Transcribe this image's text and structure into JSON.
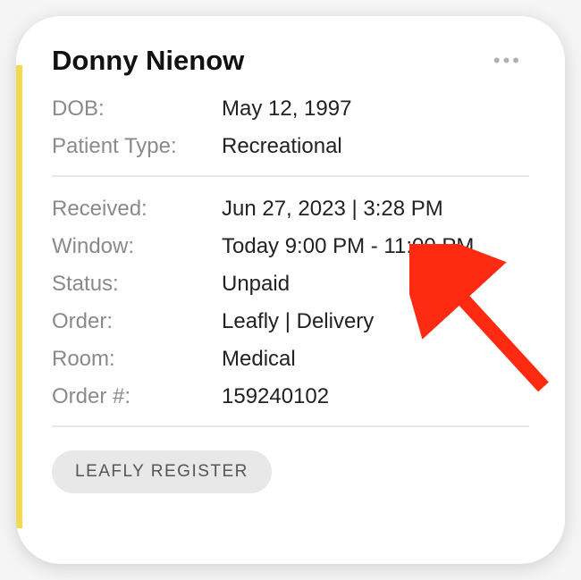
{
  "customer_name": "Donny Nienow",
  "section1": {
    "dob_label": "DOB:",
    "dob_value": "May 12, 1997",
    "patient_type_label": "Patient Type:",
    "patient_type_value": "Recreational"
  },
  "section2": {
    "received_label": "Received:",
    "received_value": "Jun 27, 2023 | 3:28 PM",
    "window_label": "Window:",
    "window_value": "Today 9:00 PM - 11:00 PM",
    "status_label": "Status:",
    "status_value": "Unpaid",
    "order_label": "Order:",
    "order_value": "Leafly | Delivery",
    "room_label": "Room:",
    "room_value": "Medical",
    "order_num_label": "Order #:",
    "order_num_value": "159240102"
  },
  "register_label": "LEAFLY REGISTER"
}
